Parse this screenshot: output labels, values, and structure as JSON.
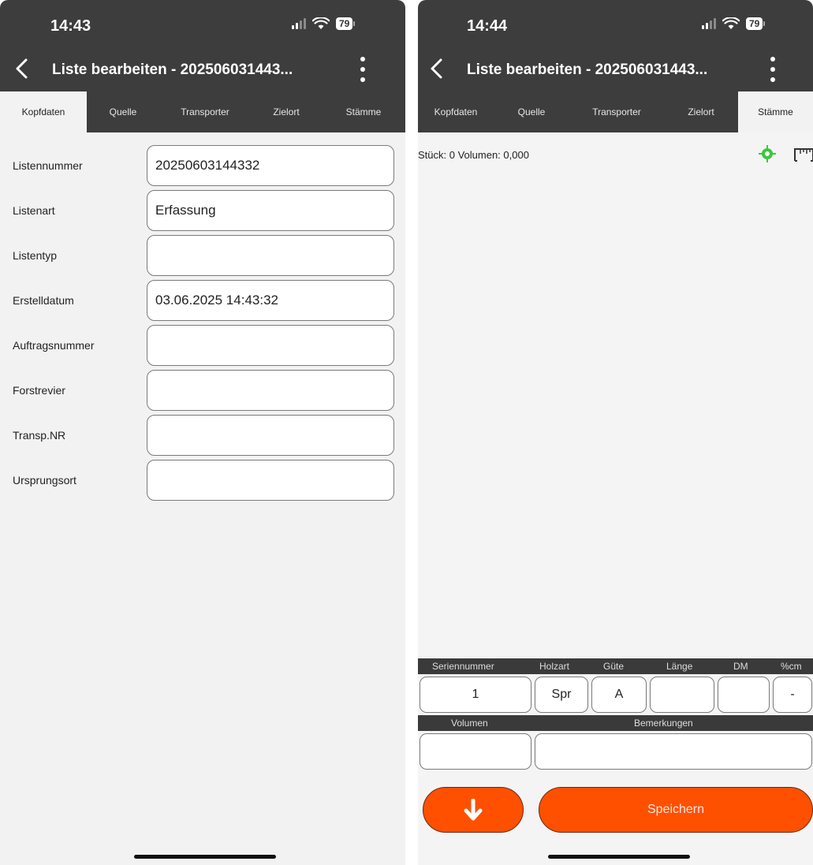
{
  "left": {
    "status": {
      "time": "14:43",
      "battery": "79"
    },
    "appbar": {
      "title": "Liste bearbeiten - 202506031443..."
    },
    "tabs": [
      {
        "label": "Kopfdaten",
        "active": true
      },
      {
        "label": "Quelle",
        "active": false
      },
      {
        "label": "Transporter",
        "active": false
      },
      {
        "label": "Zielort",
        "active": false
      },
      {
        "label": "Stämme",
        "active": false
      }
    ],
    "fields": [
      {
        "label": "Listennummer",
        "value": "20250603144332"
      },
      {
        "label": "Listenart",
        "value": "Erfassung"
      },
      {
        "label": "Listentyp",
        "value": ""
      },
      {
        "label": "Erstelldatum",
        "value": "03.06.2025 14:43:32"
      },
      {
        "label": "Auftragsnummer",
        "value": ""
      },
      {
        "label": "Forstrevier",
        "value": ""
      },
      {
        "label": "Transp.NR",
        "value": ""
      },
      {
        "label": "Ursprungsort",
        "value": ""
      }
    ]
  },
  "right": {
    "status": {
      "time": "14:44",
      "battery": "79"
    },
    "appbar": {
      "title": "Liste bearbeiten - 202506031443..."
    },
    "tabs": [
      {
        "label": "Kopfdaten",
        "active": false
      },
      {
        "label": "Quelle",
        "active": false
      },
      {
        "label": "Transporter",
        "active": false
      },
      {
        "label": "Zielort",
        "active": false
      },
      {
        "label": "Stämme",
        "active": true
      }
    ],
    "summary": "Stück: 0 Volumen: 0,000",
    "grid": {
      "headers1": [
        "Seriennummer",
        "Holzart",
        "Güte",
        "Länge",
        "DM",
        "%cm"
      ],
      "row1": {
        "seriennummer": "1",
        "holzart": "Spr",
        "guete": "A",
        "laenge": "",
        "dm": "",
        "prozent": "-"
      },
      "headers2": [
        "Volumen",
        "Bemerkungen"
      ],
      "row2": {
        "volumen": "",
        "bemerkungen": ""
      }
    },
    "buttons": {
      "save_label": "Speichern"
    }
  },
  "colors": {
    "header_bg": "#3d3d3d",
    "accent": "#ff5000",
    "gps_green": "#3cc83c"
  },
  "icons": [
    "back-arrow-icon",
    "more-vertical-icon",
    "signal-icon",
    "wifi-icon",
    "battery-icon",
    "gps-target-icon",
    "caliper-icon",
    "arrow-down-icon"
  ]
}
